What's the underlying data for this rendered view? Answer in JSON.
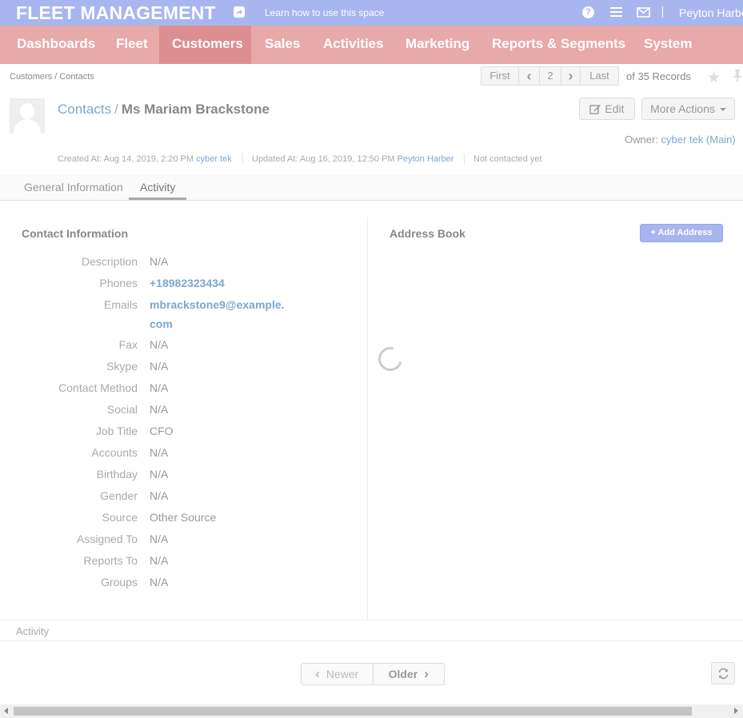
{
  "header": {
    "logo": "FLEET MANAGEMENT",
    "learn_link": "Learn how to use this space",
    "help_glyph": "?",
    "user_name": "Peyton Harber",
    "colors": {
      "top_bar": "#a7b6ee",
      "nav_bar": "#e8a9a9",
      "nav_active": "#dd8f8f",
      "link": "#7ea7cf"
    }
  },
  "nav": {
    "items": [
      {
        "label": "Dashboards"
      },
      {
        "label": "Fleet"
      },
      {
        "label": "Customers",
        "active": true
      },
      {
        "label": "Sales"
      },
      {
        "label": "Activities"
      },
      {
        "label": "Marketing"
      },
      {
        "label": "Reports & Segments"
      },
      {
        "label": "System"
      }
    ]
  },
  "breadcrumb": "Customers / Contacts",
  "pager": {
    "first": "First",
    "prev_glyph": "‹",
    "current": "2",
    "next_glyph": "›",
    "last": "Last",
    "records": "of 35 Records"
  },
  "entity": {
    "crumb": "Contacts",
    "separator": "/",
    "name": "Ms Mariam Brackstone",
    "edit_label": "Edit",
    "more_actions_label": "More Actions",
    "owner_label": "Owner:",
    "owner_name": "cyber tek",
    "owner_unit": "(Main)",
    "created_label": "Created At: Aug 14, 2019, 2:20 PM",
    "created_by": "cyber tek",
    "updated_label": "Updated At: Aug 16, 2019, 12:50 PM",
    "updated_by": "Peyton Harber",
    "contacted": "Not contacted yet"
  },
  "tabs": [
    {
      "label": "General Information"
    },
    {
      "label": "Activity",
      "active": true
    }
  ],
  "contact_info": {
    "title": "Contact Information",
    "fields": [
      {
        "label": "Description",
        "value": "N/A"
      },
      {
        "label": "Phones",
        "value": "+18982323434",
        "link": true
      },
      {
        "label": "Emails",
        "value": "mbrackstone9@example.",
        "value2": "com",
        "link": true
      },
      {
        "label": "Fax",
        "value": "N/A"
      },
      {
        "label": "Skype",
        "value": "N/A"
      },
      {
        "label": "Contact Method",
        "value": "N/A"
      },
      {
        "label": "Social",
        "value": "N/A"
      },
      {
        "label": "Job Title",
        "value": "CFO"
      },
      {
        "label": "Accounts",
        "value": "N/A"
      },
      {
        "label": "Birthday",
        "value": "N/A"
      },
      {
        "label": "Gender",
        "value": "N/A"
      },
      {
        "label": "Source",
        "value": "Other Source"
      },
      {
        "label": "Assigned To",
        "value": "N/A"
      },
      {
        "label": "Reports To",
        "value": "N/A"
      },
      {
        "label": "Groups",
        "value": "N/A"
      }
    ]
  },
  "address_book": {
    "title": "Address Book",
    "add_label": "+ Add Address"
  },
  "activity": {
    "section_label": "Activity",
    "newer_label": "Newer",
    "older_label": "Older"
  }
}
